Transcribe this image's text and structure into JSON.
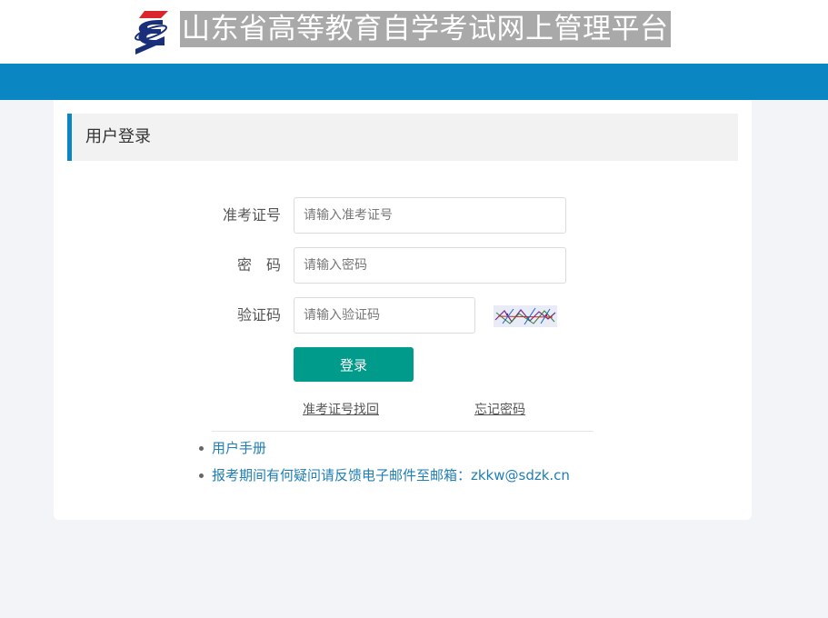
{
  "header": {
    "site_title": "山东省高等教育自学考试网上管理平台",
    "logo_icon": "exam-logo-icon"
  },
  "colors": {
    "brand_blue": "#0a86c2",
    "button_green": "#009b8a",
    "link_blue": "#1f7eb6",
    "logo_red": "#d9252b",
    "logo_navy": "#1a2f7a"
  },
  "login": {
    "title": "用户登录",
    "fields": {
      "ticket_label": "准考证号",
      "ticket_placeholder": "请输入准考证号",
      "password_label": "密　码",
      "password_placeholder": "请输入密码",
      "captcha_label": "验证码",
      "captcha_placeholder": "请输入验证码",
      "captcha_icon": "captcha-image"
    },
    "submit_label": "登录",
    "links": {
      "recover_ticket": "准考证号找回",
      "forgot_password": "忘记密码"
    }
  },
  "info": {
    "manual": "用户手册",
    "feedback": "报考期间有何疑问请反馈电子邮件至邮箱：zkkw@sdzk.cn"
  }
}
